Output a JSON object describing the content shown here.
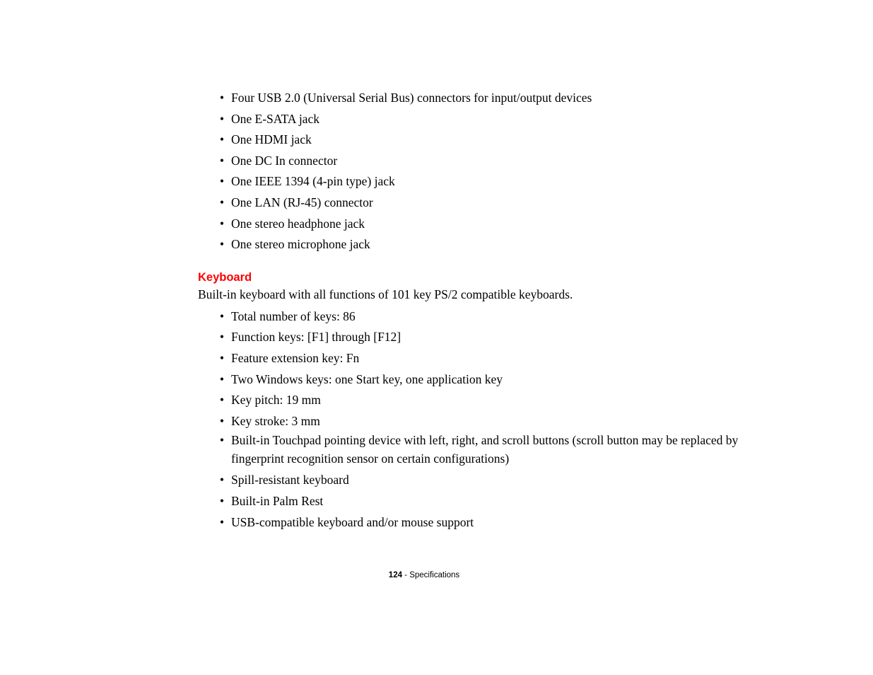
{
  "document": {
    "page_number": "124",
    "footer_separator": "-",
    "footer_section": "Specifications"
  },
  "ports_list": {
    "bullet_glyph": "•",
    "items": [
      "Four USB 2.0 (Universal Serial Bus) connectors for input/output devices",
      "One E-SATA jack",
      "One HDMI jack",
      "One DC In connector",
      "One IEEE 1394 (4-pin type) jack",
      "One LAN (RJ-45) connector",
      "One stereo headphone jack",
      "One stereo microphone jack"
    ]
  },
  "keyboard_section": {
    "heading": "Keyboard",
    "heading_color": "#FF0000",
    "intro": "Built-in keyboard with all functions of 101 key PS/2 compatible keyboards.",
    "bullet_glyph": "•",
    "items": [
      "Total number of keys: 86",
      "Function keys: [F1] through [F12]",
      "Feature extension key: Fn",
      "Two Windows keys: one Start key, one application key",
      "Key pitch: 19 mm",
      "Key stroke: 3 mm",
      "Built-in Touchpad pointing device with left, right, and scroll buttons (scroll button may be replaced by fingerprint recognition sensor on certain configurations)",
      "Spill-resistant keyboard",
      "Built-in Palm Rest",
      "USB-compatible keyboard and/or mouse support"
    ]
  }
}
